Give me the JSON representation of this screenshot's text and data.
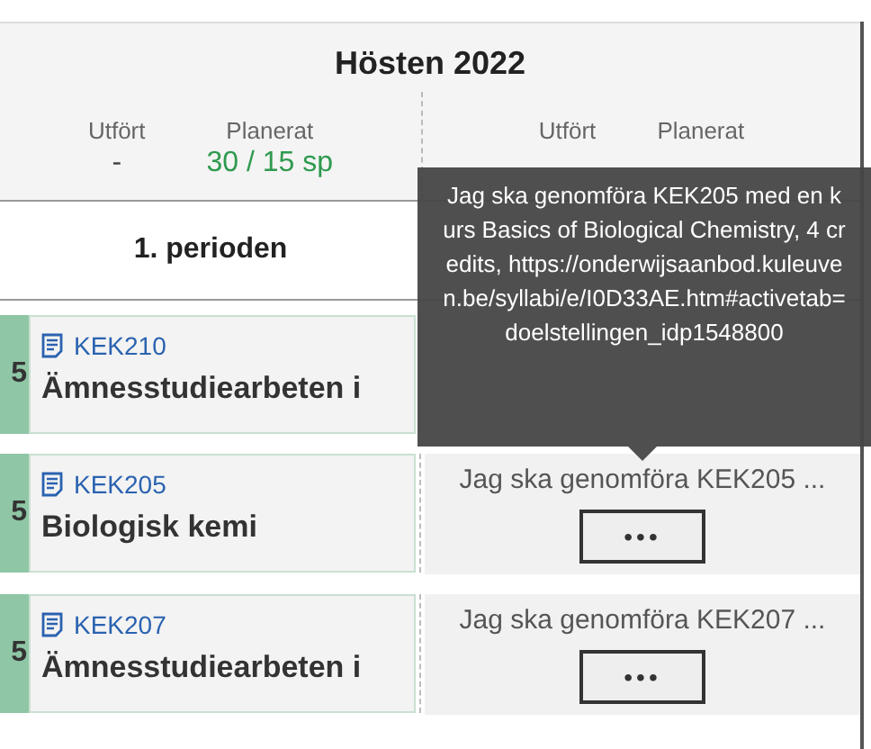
{
  "semester": {
    "title": "Hösten 2022",
    "columns": [
      {
        "stats": [
          {
            "label": "Utfört",
            "value": "-",
            "kind": "plain"
          },
          {
            "label": "Planerat",
            "value": "30 / 15 sp",
            "kind": "ok"
          }
        ],
        "period": "1. perioden"
      },
      {
        "stats": [
          {
            "label": "Utfört"
          },
          {
            "label": "Planerat"
          }
        ]
      }
    ]
  },
  "rows": [
    {
      "credits": "5",
      "code": "KEK210",
      "title": "Ämnesstudiearbeten i"
    },
    {
      "credits": "5",
      "code": "KEK205",
      "title": "Biologisk kemi",
      "note": "Jag ska genomföra KEK205 ...",
      "more_button": "•••"
    },
    {
      "credits": "5",
      "code": "KEK207",
      "title": "Ämnesstudiearbeten i",
      "note": "Jag ska genomföra KEK207 ...",
      "more_button": "•••"
    }
  ],
  "tooltip": {
    "text": "Jag ska genomföra KEK205 med en kurs Basics of Biological Chemistry, 4 credits, https://onderwijsaanbod.kuleuven.be/syllabi/e/I0D33AE.htm#activetab=doelstellingen_idp1548800"
  }
}
